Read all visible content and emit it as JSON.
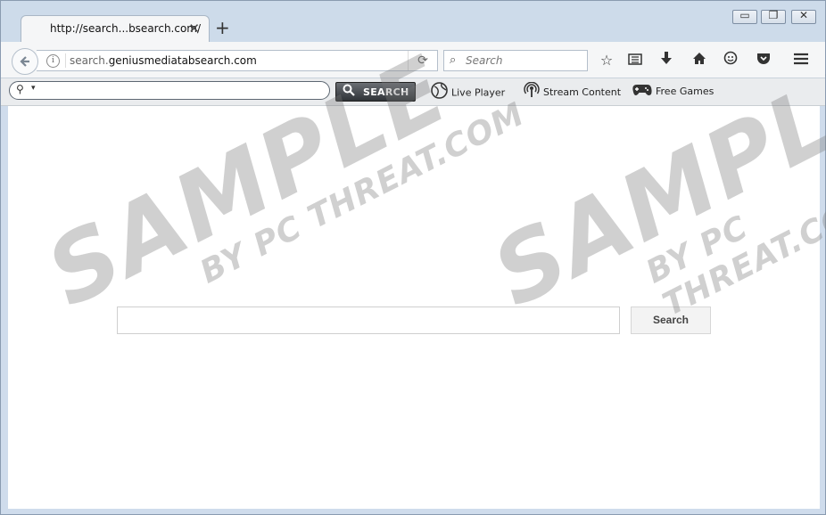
{
  "browser": {
    "tab_title": "http://search...bsearch.com/",
    "tab_close": "✕",
    "new_tab": "+",
    "window_buttons": [
      "▭",
      "❐",
      "✕"
    ],
    "url_prefix": "search.",
    "url_domain": "geniusmediatabsearch.com",
    "search_placeholder": "Search",
    "nav_icons": [
      "star-icon",
      "reading-list-icon",
      "download-icon",
      "home-icon",
      "hello-icon",
      "pocket-icon",
      "menu-icon"
    ]
  },
  "toolbar": {
    "search_button_label": "SEARCH",
    "links": [
      {
        "label": "Live Player",
        "icon": "globe-icon"
      },
      {
        "label": "Stream Content",
        "icon": "broadcast-icon"
      },
      {
        "label": "Free Games",
        "icon": "gamepad-icon"
      }
    ]
  },
  "page": {
    "search_button_label": "Search",
    "search_value": ""
  },
  "watermark": {
    "main": "SAMPLE",
    "sub": "BY PC THREAT.COM"
  }
}
